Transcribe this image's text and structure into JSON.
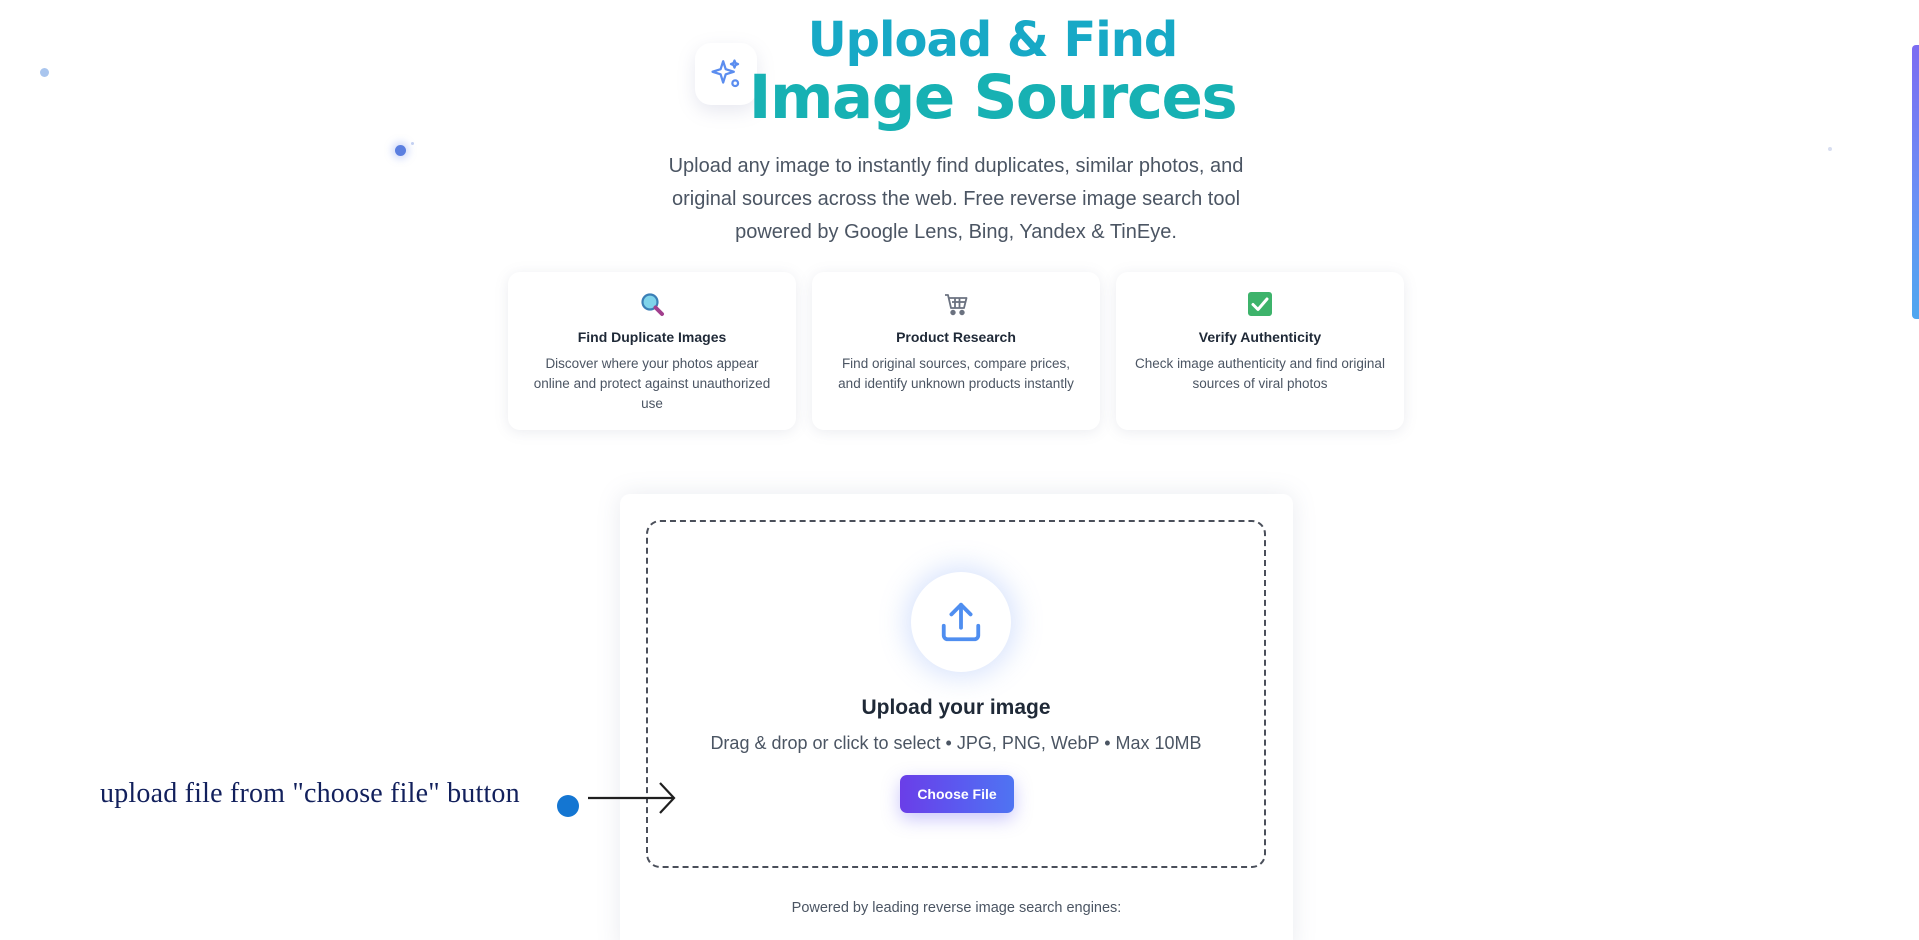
{
  "hero": {
    "title_line1": "Upload & Find",
    "title_line2": "Image Sources",
    "subtitle": "Upload any image to instantly find duplicates, similar photos, and original sources across the web. Free reverse image search tool powered by Google Lens, Bing, Yandex & TinEye.",
    "icon": "sparkles-icon"
  },
  "features": [
    {
      "icon": "magnifier-icon",
      "title": "Find Duplicate Images",
      "description": "Discover where your photos appear online and protect against unauthorized use"
    },
    {
      "icon": "shopping-cart-icon",
      "title": "Product Research",
      "description": "Find original sources, compare prices, and identify unknown products instantly"
    },
    {
      "icon": "check-mark-icon",
      "title": "Verify Authenticity",
      "description": "Check image authenticity and find original sources of viral photos"
    }
  ],
  "upload": {
    "icon": "upload-icon",
    "title": "Upload your image",
    "hint": "Drag & drop or click to select • JPG, PNG, WebP • Max 10MB",
    "button_label": "Choose File",
    "powered_by": "Powered by leading reverse image search engines:"
  },
  "annotation": {
    "text": "upload file from \"choose file\" button"
  },
  "colors": {
    "title_gradient_start": "#17a9c6",
    "title_gradient_end": "#17b1b3",
    "button_start": "#6a3ee8",
    "button_end": "#4f74f2",
    "annotation_text": "#12205c",
    "annotation_dot": "#1476d2"
  }
}
